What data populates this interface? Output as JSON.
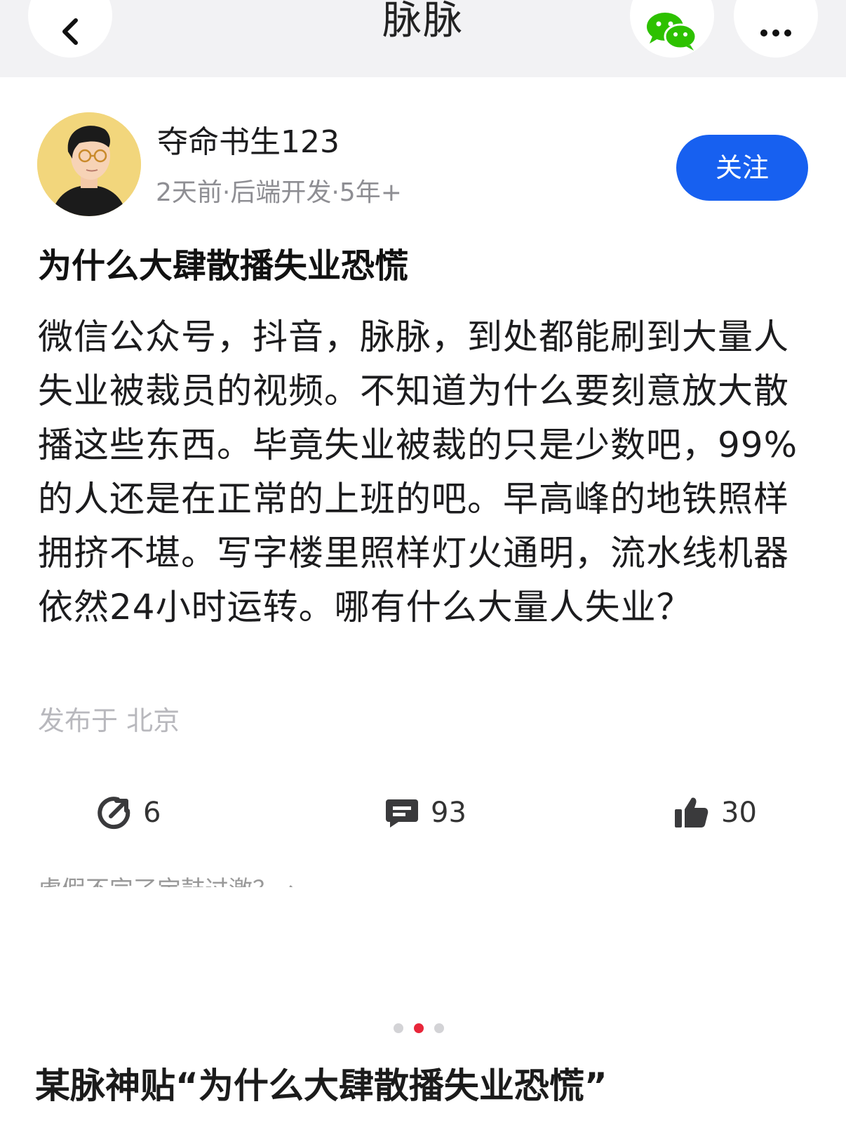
{
  "topbar": {
    "title": "脉脉",
    "back_icon": "chevron-left-icon",
    "wechat_icon": "wechat-icon",
    "more_icon": "more-dots-icon"
  },
  "post": {
    "author": "夺命书生123",
    "meta": "2天前·后端开发·5年+",
    "follow_label": "关注",
    "title": "为什么大肆散播失业恐慌",
    "body": "微信公众号，抖音，脉脉，到处都能刷到大量人失业被裁员的视频。不知道为什么要刻意放大散播这些东西。毕竟失业被裁的只是少数吧，99%的人还是在正常的上班的吧。早高峰的地铁照样拥挤不堪。写字楼里照样灯火通明，流水线机器依然24小时运转。哪有什么大量人失业？",
    "location": "发布于 北京"
  },
  "actions": {
    "share_count": "6",
    "comment_count": "93",
    "like_count": "30"
  },
  "partial_line": "虚假不完了宝鼓过激？→",
  "carousel": {
    "total": 3,
    "active": 2
  },
  "caption": "某脉神贴“为什么大肆散播失业恐慌”",
  "colors": {
    "accent": "#1760f0",
    "dot_active": "#e8263a",
    "wechat_green": "#2dc100"
  }
}
